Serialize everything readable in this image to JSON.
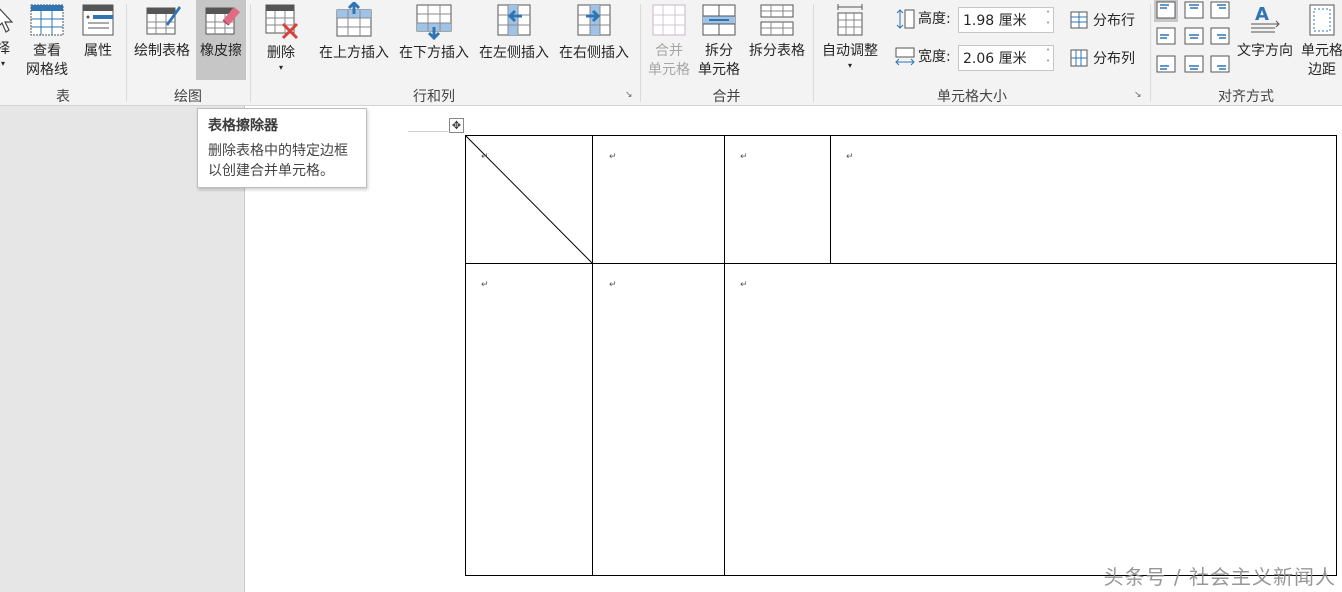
{
  "ribbon": {
    "groups": {
      "table": "表",
      "draw": "绘图",
      "rows_cols": "行和列",
      "merge": "合并",
      "cell_size": "单元格大小",
      "align": "对齐方式"
    },
    "select_label_partial": "择",
    "view_gridlines_line1": "查看",
    "view_gridlines_line2": "网格线",
    "properties": "属性",
    "draw_table": "绘制表格",
    "eraser": "橡皮擦",
    "delete": "删除",
    "insert_above": "在上方插入",
    "insert_below": "在下方插入",
    "insert_left": "在左侧插入",
    "insert_right": "在右侧插入",
    "merge_cells_line1": "合并",
    "merge_cells_line2": "单元格",
    "split_cells_line1": "拆分",
    "split_cells_line2": "单元格",
    "split_table": "拆分表格",
    "autofit": "自动调整",
    "height_label": "高度:",
    "height_value": "1.98 厘米",
    "width_label": "宽度:",
    "width_value": "2.06 厘米",
    "distribute_rows": "分布行",
    "distribute_cols": "分布列",
    "text_direction": "文字方向",
    "cell_margins_line1": "单元格",
    "cell_margins_line2": "边距"
  },
  "tooltip": {
    "title": "表格擦除器",
    "body_line1": "删除表格中的特定边框",
    "body_line2": "以创建合并单元格。"
  },
  "document": {
    "paragraph_mark": "↵"
  },
  "watermark": "头条号 / 社会主义新闻人",
  "colors": {
    "ribbon_bg": "#f3f3f3",
    "active_button": "#c6c6c6",
    "accent_blue": "#2e75b6",
    "eraser_pink": "#e06c84",
    "delete_red": "#d9403a"
  }
}
